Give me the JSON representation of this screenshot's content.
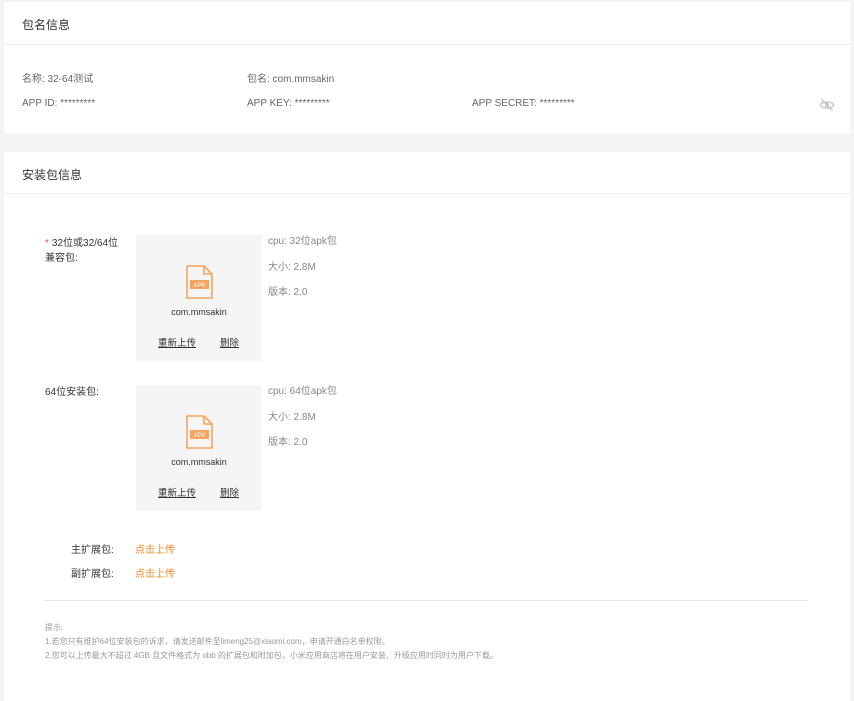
{
  "package_info": {
    "title": "包名信息",
    "name": "名称: 32-64测试",
    "package": "包名: com.mmsakin",
    "app_id": "APP ID: *********",
    "app_key": "APP KEY: *********",
    "app_secret": "APP SECRET: *********"
  },
  "install_info": {
    "title": "安装包信息",
    "pkg32": {
      "required_mark": "*",
      "label_line1": "32位或32/64位",
      "label_line2": "兼容包:",
      "file_name": "com.mmsakin",
      "icon_text": "APK",
      "reupload": "重新上传",
      "delete": "删除",
      "cpu": "cpu: 32位apk包",
      "size": "大小: 2.8M",
      "version": "版本: 2.0"
    },
    "pkg64": {
      "label": "64位安装包:",
      "file_name": "com.mmsakin",
      "icon_text": "APK",
      "reupload": "重新上传",
      "delete": "删除",
      "cpu": "cpu: 64位apk包",
      "size": "大小: 2.8M",
      "version": "版本: 2.0"
    },
    "main_ext": {
      "label": "主扩展包:",
      "action": "点击上传"
    },
    "sub_ext": {
      "label": "副扩展包:",
      "action": "点击上传"
    },
    "tips": {
      "title": "提示:",
      "line1": "1.若您只有维护64位安装包的诉求，请发送邮件至limeng25@xiaomi.com，申请开通白名单权限。",
      "line2": "2.您可以上传最大不超过 4GB 且文件格式为 obb 的扩展包和附加包，小米应用商店将在用户安装、升级应用时同时为用户下载。"
    }
  },
  "colors": {
    "accent": "#f38a2a",
    "required": "#f24e4e",
    "apk_icon": "#f5a45d"
  },
  "icons": {
    "visibility_toggle": "eye-off-icon",
    "file": "apk-file-icon"
  }
}
